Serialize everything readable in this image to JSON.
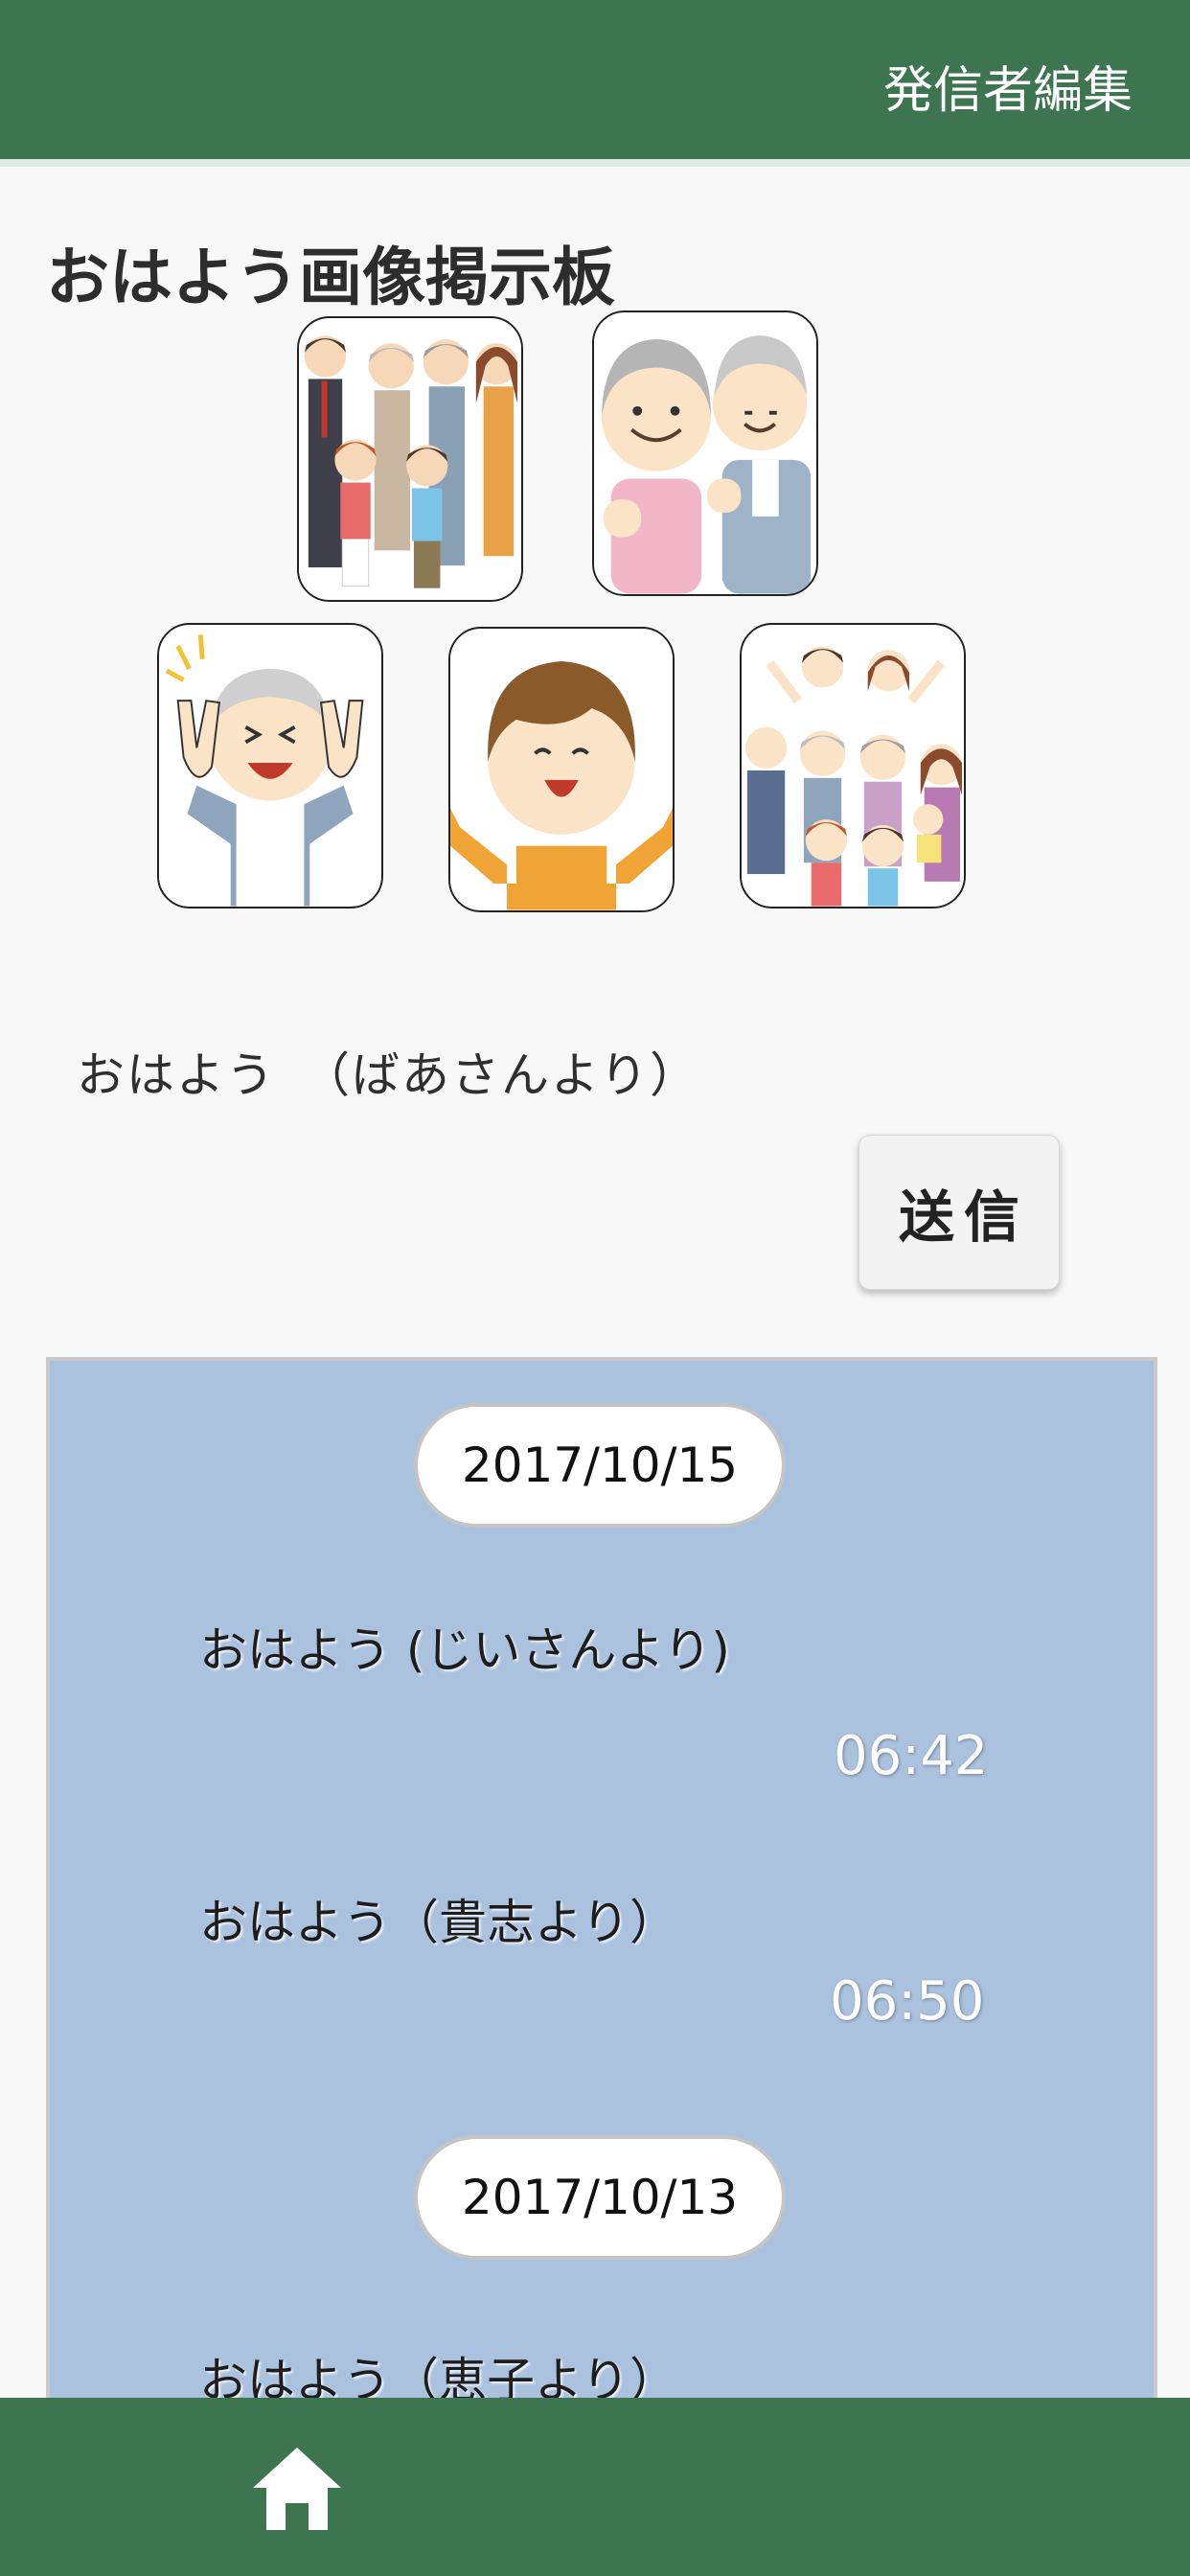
{
  "header": {
    "edit_label": "発信者編集"
  },
  "page": {
    "title": "おはよう画像掲示板"
  },
  "stamps": [
    {
      "name": "family-group-stamp"
    },
    {
      "name": "grandparents-stamp"
    },
    {
      "name": "grandpa-peace-stamp"
    },
    {
      "name": "boy-cheer-stamp"
    },
    {
      "name": "big-family-stamp"
    }
  ],
  "composer": {
    "selected_message": "おはよう　（ばあさんより）",
    "send_label": "送信"
  },
  "board": {
    "groups": [
      {
        "date": "2017/10/15",
        "messages": [
          {
            "text": "おはよう (じいさんより)",
            "time": "06:42"
          },
          {
            "text": "おはよう（貴志より）",
            "time": "06:50"
          }
        ]
      },
      {
        "date": "2017/10/13",
        "messages": [
          {
            "text": "おはよう（恵子より）",
            "time": ""
          }
        ]
      }
    ]
  },
  "bottom_nav": {
    "home_icon": "home-icon"
  },
  "colors": {
    "header_bg": "#3e7551",
    "board_bg": "#abc2de",
    "page_bg": "#f8f8f8"
  }
}
